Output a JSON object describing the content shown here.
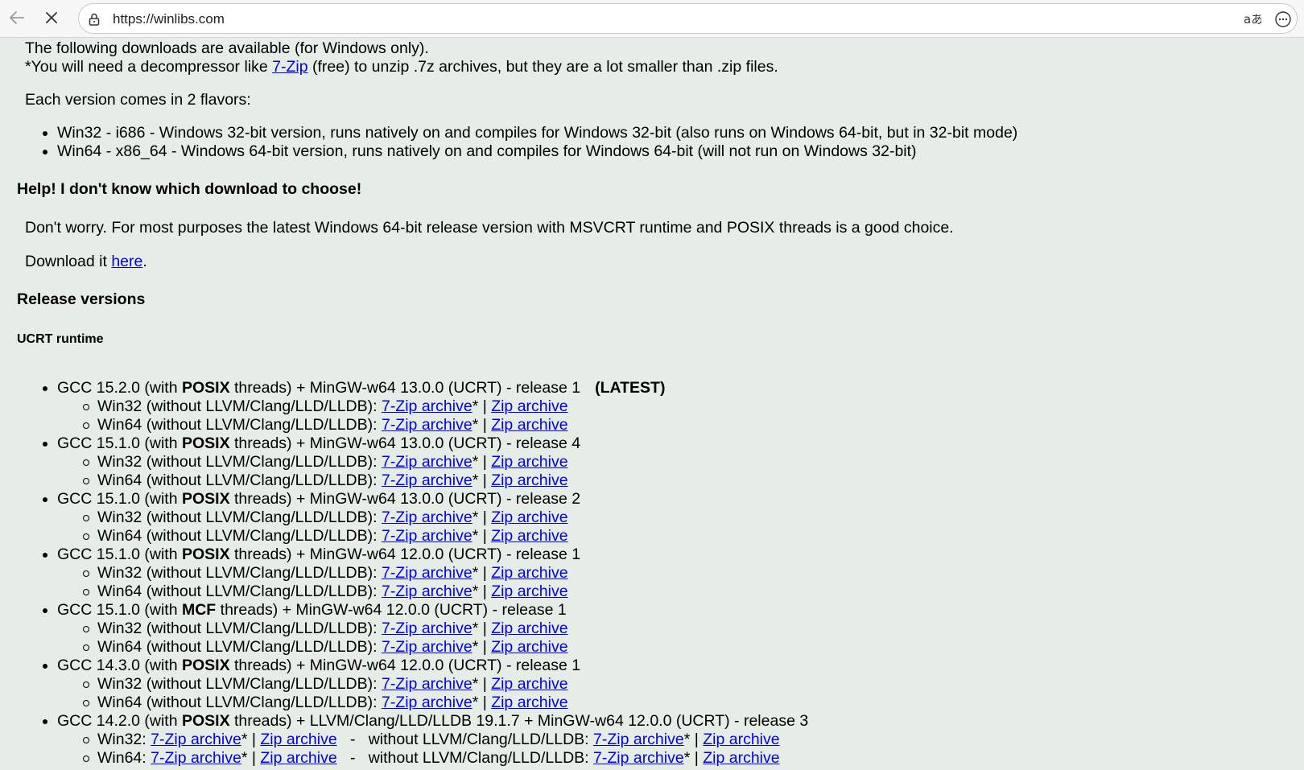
{
  "browser": {
    "url": "https://winlibs.com"
  },
  "intro": {
    "line1": "The following downloads are available (for Windows only).",
    "line2_prefix": "*You will need a decompressor like ",
    "line2_link": "7-Zip",
    "line2_suffix": " (free) to unzip .7z archives, but they are a lot smaller than .zip files.",
    "flavors_intro": "Each version comes in 2 flavors:",
    "flavors": [
      "Win32 - i686 - Windows 32-bit version, runs natively on and compiles for Windows 32-bit (also runs on Windows 64-bit, but in 32-bit mode)",
      "Win64 - x86_64 - Windows 64-bit version, runs natively on and compiles for Windows 64-bit (will not run on Windows 32-bit)"
    ]
  },
  "help": {
    "heading": "Help! I don't know which download to choose!",
    "text": "Don't worry. For most purposes the latest Windows 64-bit release version with MSVCRT runtime and POSIX threads is a good choice.",
    "download_prefix": "Download it ",
    "download_link": "here",
    "download_suffix": "."
  },
  "releases": {
    "heading": "Release versions",
    "subheading": "UCRT runtime",
    "common": {
      "win32_label": "Win32 (without LLVM/Clang/LLD/LLDB): ",
      "win64_label": "Win64 (without LLVM/Clang/LLD/LLDB): ",
      "sevenzip": "7-Zip archive",
      "star_sep": "* | ",
      "zip": "Zip archive",
      "with_prefix": " (with ",
      "threads_mid": " threads) + "
    },
    "items": [
      {
        "gcc": "GCC 15.2.0",
        "thread": "POSIX",
        "rest": "MinGW-w64 13.0.0 (UCRT) - release 1",
        "tag": "(LATEST)"
      },
      {
        "gcc": "GCC 15.1.0",
        "thread": "POSIX",
        "rest": "MinGW-w64 13.0.0 (UCRT) - release 4"
      },
      {
        "gcc": "GCC 15.1.0",
        "thread": "POSIX",
        "rest": "MinGW-w64 13.0.0 (UCRT) - release 2"
      },
      {
        "gcc": "GCC 15.1.0",
        "thread": "POSIX",
        "rest": "MinGW-w64 12.0.0 (UCRT) - release 1"
      },
      {
        "gcc": "GCC 15.1.0",
        "thread": "MCF",
        "rest": "MinGW-w64 12.0.0 (UCRT) - release 1"
      },
      {
        "gcc": "GCC 14.3.0",
        "thread": "POSIX",
        "rest": "MinGW-w64 12.0.0 (UCRT) - release 1"
      }
    ],
    "llvm_item": {
      "gcc": "GCC 14.2.0",
      "thread": "POSIX",
      "rest": "LLVM/Clang/LLD/LLDB 19.1.7 + MinGW-w64 12.0.0 (UCRT) - release 3",
      "win32_label": "Win32: ",
      "win64_label": "Win64: ",
      "without_label": "   -   without LLVM/Clang/LLD/LLDB: "
    }
  },
  "icons": {
    "back": "back-arrow-icon",
    "stop": "close-icon",
    "lock": "lock-icon",
    "translate": "translate-icon",
    "more": "more-options-icon"
  }
}
